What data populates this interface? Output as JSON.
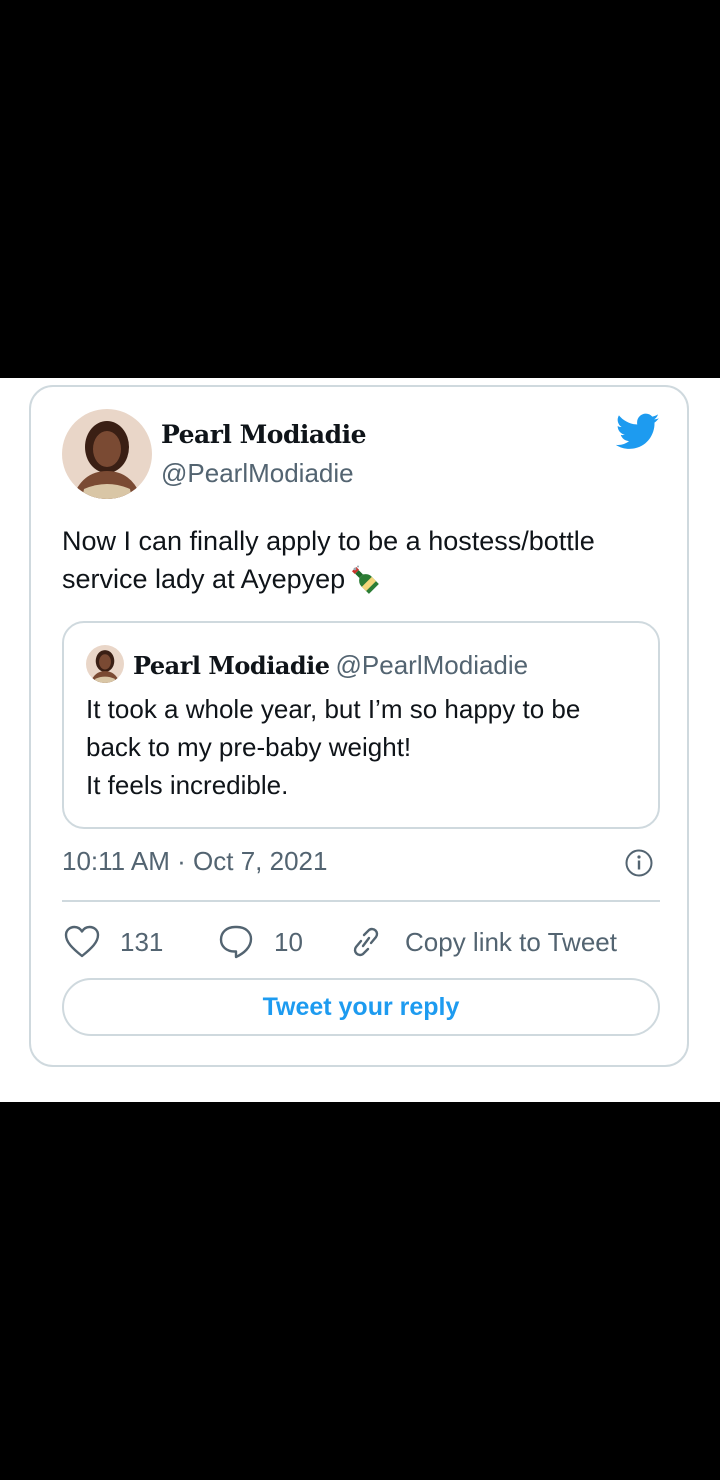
{
  "author": {
    "display_name": "Pearl Modiadie",
    "handle": "@PearlModiadie"
  },
  "tweet": {
    "text": "Now I can finally apply to be a hostess/bottle service lady at Ayepyep"
  },
  "quoted_tweet": {
    "display_name": "Pearl Modiadie",
    "handle": "@PearlModiadie",
    "lines": [
      "It took a whole year, but I’m so happy to be",
      "back to my pre-baby weight!",
      "It feels incredible."
    ]
  },
  "timestamp": "10:11 AM · Oct 7, 2021",
  "actions": {
    "likes": "131",
    "replies": "10",
    "copy_link_label": "Copy link to Tweet"
  },
  "reply_button_label": "Tweet your reply",
  "colors": {
    "accent": "#1d9bf0",
    "secondary_text": "#536471",
    "border": "#cfd9de"
  },
  "icons": [
    "twitter-bird-icon",
    "bottle-emoji-icon",
    "info-icon",
    "heart-icon",
    "reply-bubble-icon",
    "link-icon"
  ]
}
